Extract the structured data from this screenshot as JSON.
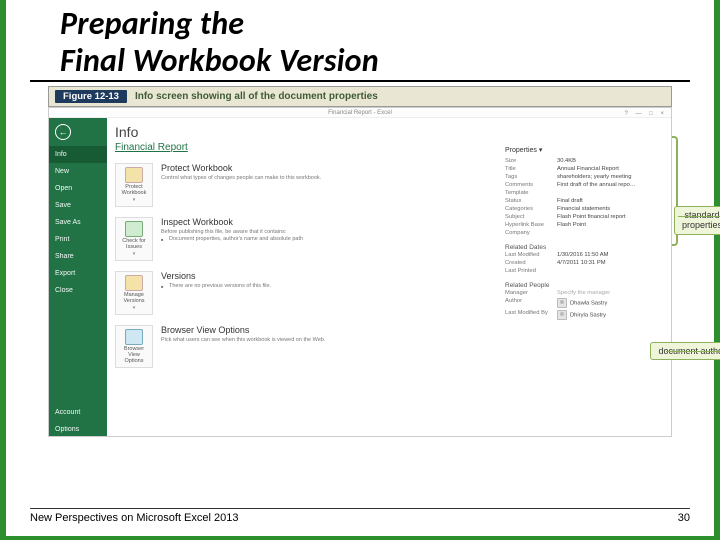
{
  "slide": {
    "title_line1": "Preparing the",
    "title_line2": "Final Workbook Version"
  },
  "figure": {
    "number": "Figure 12-13",
    "caption": "Info screen showing all of the document properties"
  },
  "window": {
    "titlebar": "Financial Report - Excel",
    "controls": "? — □ ×"
  },
  "nav": {
    "back": "←",
    "items": [
      "Info",
      "New",
      "Open",
      "Save",
      "Save As",
      "Print",
      "Share",
      "Export",
      "Close",
      "Account",
      "Options"
    ]
  },
  "info": {
    "heading": "Info",
    "doc_title": "Financial Report",
    "sections": {
      "protect": {
        "btn": "Protect Workbook",
        "drop": "▾",
        "h": "Protect Workbook",
        "p": "Control what types of changes people can make to this workbook."
      },
      "inspect": {
        "btn": "Check for Issues",
        "drop": "▾",
        "h": "Inspect Workbook",
        "p": "Before publishing this file, be aware that it contains:",
        "li": "Document properties, author's name and absolute path"
      },
      "versions": {
        "btn": "Manage Versions",
        "drop": "▾",
        "h": "Versions",
        "li": "There are no previous versions of this file."
      },
      "browser": {
        "btn": "Browser View Options",
        "h": "Browser View Options",
        "p": "Pick what users can see when this workbook is viewed on the Web."
      }
    }
  },
  "properties": {
    "heading": "Properties ▾",
    "rows": [
      {
        "k": "Size",
        "v": "30.4KB"
      },
      {
        "k": "Title",
        "v": "Annual Financial Report"
      },
      {
        "k": "Tags",
        "v": "shareholders; yearly meeting"
      },
      {
        "k": "Comments",
        "v": "First draft of the annual repo…"
      },
      {
        "k": "Template",
        "v": ""
      },
      {
        "k": "Status",
        "v": "Final draft"
      },
      {
        "k": "Categories",
        "v": "Financial statements"
      },
      {
        "k": "Subject",
        "v": "Flash Point financial report"
      },
      {
        "k": "Hyperlink Base",
        "v": "Flash Point"
      },
      {
        "k": "Company",
        "v": ""
      }
    ],
    "related_dates": {
      "label": "Related Dates",
      "rows": [
        {
          "k": "Last Modified",
          "v": "1/30/2016 11:50 AM"
        },
        {
          "k": "Created",
          "v": "4/7/2011 10:31 PM"
        },
        {
          "k": "Last Printed",
          "v": ""
        }
      ]
    },
    "related_people": {
      "label": "Related People",
      "manager_k": "Manager",
      "manager_v": "Specify the manager",
      "author_k": "Author",
      "author_v": "Dhawla Sastry",
      "lastmod_k": "Last Modified By",
      "lastmod_v": "Dhiryla Sastry"
    }
  },
  "callouts": {
    "standard": "standard\nproperties",
    "author": "document author"
  },
  "footer": {
    "left": "New Perspectives on Microsoft Excel 2013",
    "right": "30"
  }
}
